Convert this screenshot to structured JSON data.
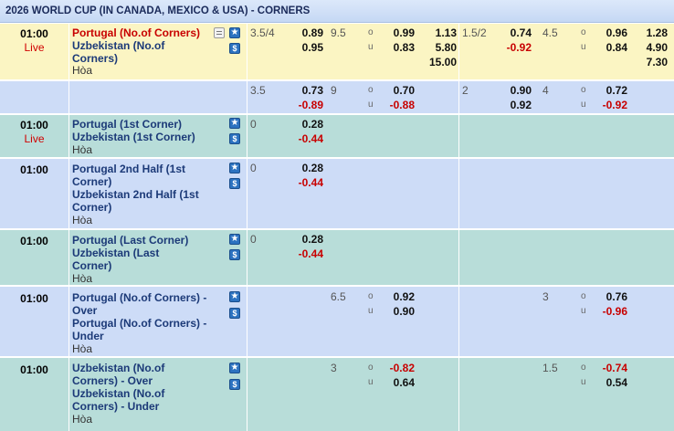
{
  "header": {
    "title": "2026 WORLD CUP (IN CANADA, MEXICO & USA) - CORNERS"
  },
  "labels": {
    "over": "o",
    "under": "u",
    "draw": "Hòa",
    "live": "Live"
  },
  "matches": [
    {
      "time": "01:00",
      "live": "Live",
      "home": "Portugal (No.of Corners)",
      "away": "Uzbekistan (No.of Corners)",
      "draw": "Hòa",
      "ft_hdp": {
        "line": "3.5/4",
        "home": "0.89",
        "away": "0.95"
      },
      "ft_ou": {
        "line": "9.5",
        "over": "0.99",
        "under": "0.83"
      },
      "ft_1x2": {
        "home": "1.13",
        "away": "5.80",
        "draw": "15.00"
      },
      "h1_hdp": {
        "line": "1.5/2",
        "home": "0.74",
        "away": "-0.92"
      },
      "h1_ou": {
        "line": "4.5",
        "over": "0.96",
        "under": "0.84"
      },
      "h1_1x2": {
        "home": "1.28",
        "away": "4.90",
        "draw": "7.30"
      }
    },
    {
      "ft_hdp": {
        "line": "3.5",
        "home": "0.73",
        "away": "-0.89"
      },
      "ft_ou": {
        "line": "9",
        "over": "0.70",
        "under": "-0.88"
      },
      "h1_hdp": {
        "line": "2",
        "home": "0.90",
        "away": "0.92"
      },
      "h1_ou": {
        "line": "4",
        "over": "0.72",
        "under": "-0.92"
      }
    },
    {
      "time": "01:00",
      "live": "Live",
      "home": "Portugal (1st Corner)",
      "away": "Uzbekistan (1st Corner)",
      "draw": "Hòa",
      "ft_hdp": {
        "line": "0",
        "home": "0.28",
        "away": "-0.44"
      }
    },
    {
      "time": "01:00",
      "home": "Portugal 2nd Half (1st Corner)",
      "away": "Uzbekistan 2nd Half (1st Corner)",
      "draw": "Hòa",
      "ft_hdp": {
        "line": "0",
        "home": "0.28",
        "away": "-0.44"
      }
    },
    {
      "time": "01:00",
      "home": "Portugal (Last Corner)",
      "away": "Uzbekistan (Last Corner)",
      "draw": "Hòa",
      "ft_hdp": {
        "line": "0",
        "home": "0.28",
        "away": "-0.44"
      }
    },
    {
      "time": "01:00",
      "home": "Portugal (No.of Corners) - Over",
      "away": "Portugal (No.of Corners) - Under",
      "draw": "Hòa",
      "ft_ou": {
        "line": "6.5",
        "over": "0.92",
        "under": "0.90"
      },
      "h1_ou": {
        "line": "3",
        "over": "0.76",
        "under": "-0.96"
      }
    },
    {
      "time": "01:00",
      "home": "Uzbekistan (No.of Corners) - Over",
      "away": "Uzbekistan (No.of Corners) - Under",
      "draw": "Hòa",
      "ft_ou": {
        "line": "3",
        "over": "-0.82",
        "under": "0.64"
      },
      "h1_ou": {
        "line": "1.5",
        "over": "-0.74",
        "under": "0.54"
      }
    }
  ],
  "colors": {
    "yellow_row": "#fbf5c3",
    "blue_row": "#cddcf7",
    "teal_row": "#b8ddd9",
    "negative": "#c80000",
    "team": "#1c3a78",
    "favourite_team": "#c80000"
  },
  "icons": {
    "favourite": "star-icon",
    "bet": "dollar-icon",
    "stats": "stats-icon"
  }
}
